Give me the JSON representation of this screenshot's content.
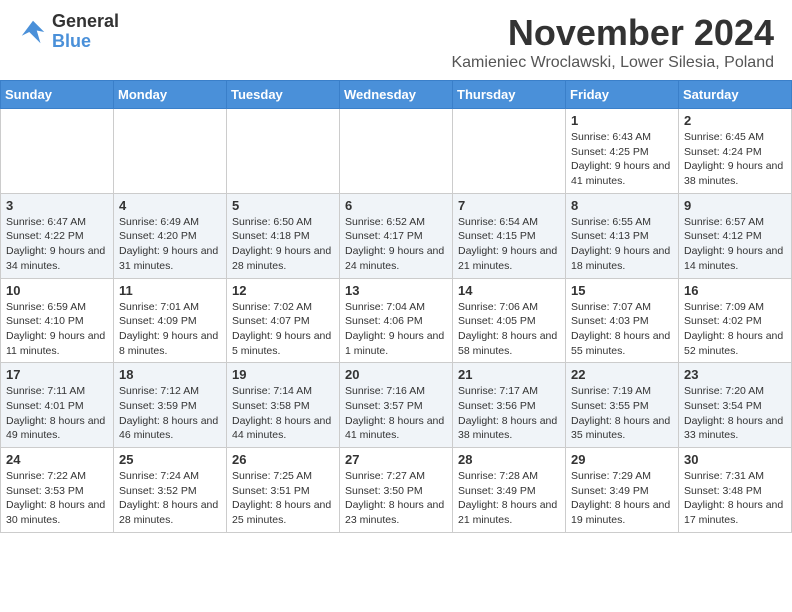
{
  "header": {
    "logo_text_general": "General",
    "logo_text_blue": "Blue",
    "month_title": "November 2024",
    "location": "Kamieniec Wroclawski, Lower Silesia, Poland"
  },
  "calendar": {
    "days_of_week": [
      "Sunday",
      "Monday",
      "Tuesday",
      "Wednesday",
      "Thursday",
      "Friday",
      "Saturday"
    ],
    "weeks": [
      [
        {
          "day": "",
          "info": ""
        },
        {
          "day": "",
          "info": ""
        },
        {
          "day": "",
          "info": ""
        },
        {
          "day": "",
          "info": ""
        },
        {
          "day": "",
          "info": ""
        },
        {
          "day": "1",
          "info": "Sunrise: 6:43 AM\nSunset: 4:25 PM\nDaylight: 9 hours and 41 minutes."
        },
        {
          "day": "2",
          "info": "Sunrise: 6:45 AM\nSunset: 4:24 PM\nDaylight: 9 hours and 38 minutes."
        }
      ],
      [
        {
          "day": "3",
          "info": "Sunrise: 6:47 AM\nSunset: 4:22 PM\nDaylight: 9 hours and 34 minutes."
        },
        {
          "day": "4",
          "info": "Sunrise: 6:49 AM\nSunset: 4:20 PM\nDaylight: 9 hours and 31 minutes."
        },
        {
          "day": "5",
          "info": "Sunrise: 6:50 AM\nSunset: 4:18 PM\nDaylight: 9 hours and 28 minutes."
        },
        {
          "day": "6",
          "info": "Sunrise: 6:52 AM\nSunset: 4:17 PM\nDaylight: 9 hours and 24 minutes."
        },
        {
          "day": "7",
          "info": "Sunrise: 6:54 AM\nSunset: 4:15 PM\nDaylight: 9 hours and 21 minutes."
        },
        {
          "day": "8",
          "info": "Sunrise: 6:55 AM\nSunset: 4:13 PM\nDaylight: 9 hours and 18 minutes."
        },
        {
          "day": "9",
          "info": "Sunrise: 6:57 AM\nSunset: 4:12 PM\nDaylight: 9 hours and 14 minutes."
        }
      ],
      [
        {
          "day": "10",
          "info": "Sunrise: 6:59 AM\nSunset: 4:10 PM\nDaylight: 9 hours and 11 minutes."
        },
        {
          "day": "11",
          "info": "Sunrise: 7:01 AM\nSunset: 4:09 PM\nDaylight: 9 hours and 8 minutes."
        },
        {
          "day": "12",
          "info": "Sunrise: 7:02 AM\nSunset: 4:07 PM\nDaylight: 9 hours and 5 minutes."
        },
        {
          "day": "13",
          "info": "Sunrise: 7:04 AM\nSunset: 4:06 PM\nDaylight: 9 hours and 1 minute."
        },
        {
          "day": "14",
          "info": "Sunrise: 7:06 AM\nSunset: 4:05 PM\nDaylight: 8 hours and 58 minutes."
        },
        {
          "day": "15",
          "info": "Sunrise: 7:07 AM\nSunset: 4:03 PM\nDaylight: 8 hours and 55 minutes."
        },
        {
          "day": "16",
          "info": "Sunrise: 7:09 AM\nSunset: 4:02 PM\nDaylight: 8 hours and 52 minutes."
        }
      ],
      [
        {
          "day": "17",
          "info": "Sunrise: 7:11 AM\nSunset: 4:01 PM\nDaylight: 8 hours and 49 minutes."
        },
        {
          "day": "18",
          "info": "Sunrise: 7:12 AM\nSunset: 3:59 PM\nDaylight: 8 hours and 46 minutes."
        },
        {
          "day": "19",
          "info": "Sunrise: 7:14 AM\nSunset: 3:58 PM\nDaylight: 8 hours and 44 minutes."
        },
        {
          "day": "20",
          "info": "Sunrise: 7:16 AM\nSunset: 3:57 PM\nDaylight: 8 hours and 41 minutes."
        },
        {
          "day": "21",
          "info": "Sunrise: 7:17 AM\nSunset: 3:56 PM\nDaylight: 8 hours and 38 minutes."
        },
        {
          "day": "22",
          "info": "Sunrise: 7:19 AM\nSunset: 3:55 PM\nDaylight: 8 hours and 35 minutes."
        },
        {
          "day": "23",
          "info": "Sunrise: 7:20 AM\nSunset: 3:54 PM\nDaylight: 8 hours and 33 minutes."
        }
      ],
      [
        {
          "day": "24",
          "info": "Sunrise: 7:22 AM\nSunset: 3:53 PM\nDaylight: 8 hours and 30 minutes."
        },
        {
          "day": "25",
          "info": "Sunrise: 7:24 AM\nSunset: 3:52 PM\nDaylight: 8 hours and 28 minutes."
        },
        {
          "day": "26",
          "info": "Sunrise: 7:25 AM\nSunset: 3:51 PM\nDaylight: 8 hours and 25 minutes."
        },
        {
          "day": "27",
          "info": "Sunrise: 7:27 AM\nSunset: 3:50 PM\nDaylight: 8 hours and 23 minutes."
        },
        {
          "day": "28",
          "info": "Sunrise: 7:28 AM\nSunset: 3:49 PM\nDaylight: 8 hours and 21 minutes."
        },
        {
          "day": "29",
          "info": "Sunrise: 7:29 AM\nSunset: 3:49 PM\nDaylight: 8 hours and 19 minutes."
        },
        {
          "day": "30",
          "info": "Sunrise: 7:31 AM\nSunset: 3:48 PM\nDaylight: 8 hours and 17 minutes."
        }
      ]
    ]
  }
}
